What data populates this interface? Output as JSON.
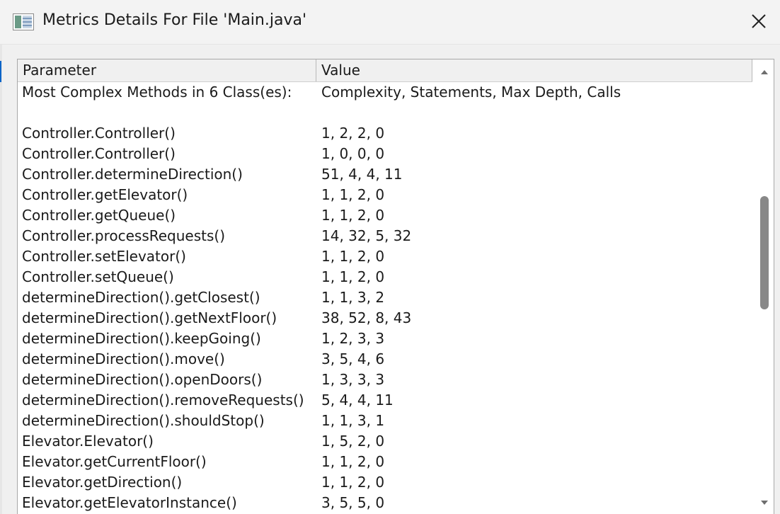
{
  "window": {
    "title": "Metrics Details For File 'Main.java'",
    "icon": "metrics-app-icon",
    "close_icon": "close-x"
  },
  "table": {
    "headers": [
      "Parameter",
      "Value"
    ],
    "rows": [
      [
        "Most Complex Methods in 6 Class(es):",
        "Complexity, Statements, Max Depth, Calls"
      ],
      [
        "",
        ""
      ],
      [
        "Controller.Controller()",
        "1, 2, 2, 0"
      ],
      [
        "Controller.Controller()",
        "1, 0, 0, 0"
      ],
      [
        "Controller.determineDirection()",
        "51, 4, 4, 11"
      ],
      [
        "Controller.getElevator()",
        "1, 1, 2, 0"
      ],
      [
        "Controller.getQueue()",
        "1, 1, 2, 0"
      ],
      [
        "Controller.processRequests()",
        "14, 32, 5, 32"
      ],
      [
        "Controller.setElevator()",
        "1, 1, 2, 0"
      ],
      [
        "Controller.setQueue()",
        "1, 1, 2, 0"
      ],
      [
        "determineDirection().getClosest()",
        "1, 1, 3, 2"
      ],
      [
        "determineDirection().getNextFloor()",
        "38, 52, 8, 43"
      ],
      [
        "determineDirection().keepGoing()",
        "1, 2, 3, 3"
      ],
      [
        "determineDirection().move()",
        "3, 5, 4, 6"
      ],
      [
        "determineDirection().openDoors()",
        "1, 3, 3, 3"
      ],
      [
        "determineDirection().removeRequests()",
        "5, 4, 4, 11"
      ],
      [
        "determineDirection().shouldStop()",
        "1, 1, 3, 1"
      ],
      [
        "Elevator.Elevator()",
        "1, 5, 2, 0"
      ],
      [
        "Elevator.getCurrentFloor()",
        "1, 1, 2, 0"
      ],
      [
        "Elevator.getDirection()",
        "1, 1, 2, 0"
      ],
      [
        "Elevator.getElevatorInstance()",
        "3, 5, 5, 0"
      ]
    ]
  },
  "scrollbar": {
    "up_icon": "scroll-up-arrow",
    "down_icon": "scroll-down-arrow"
  },
  "colors": {
    "accent": "#0a64c8",
    "thumb": "#888888"
  }
}
